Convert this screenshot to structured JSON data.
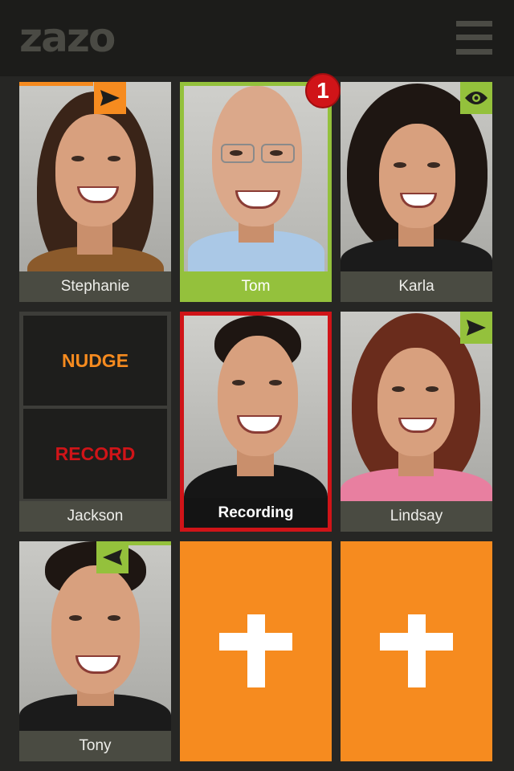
{
  "app": {
    "logo": "zazo"
  },
  "colors": {
    "accent_orange": "#f68b1f",
    "accent_green": "#94c13c",
    "record_red": "#d01418"
  },
  "contacts": [
    {
      "name": "Stephanie",
      "status_icon": "send-arrow-icon"
    },
    {
      "name": "Tom",
      "unread_count": "1"
    },
    {
      "name": "Karla",
      "status_icon": "eye-icon"
    },
    {
      "name": "Jackson",
      "nudge_label": "NUDGE",
      "record_label": "RECORD"
    },
    {
      "name": "Recording"
    },
    {
      "name": "Lindsay",
      "status_icon": "send-arrow-icon"
    },
    {
      "name": "Tony",
      "status_icon": "received-arrow-icon"
    }
  ],
  "add_slots": [
    {
      "icon": "plus-icon"
    },
    {
      "icon": "plus-icon"
    }
  ]
}
